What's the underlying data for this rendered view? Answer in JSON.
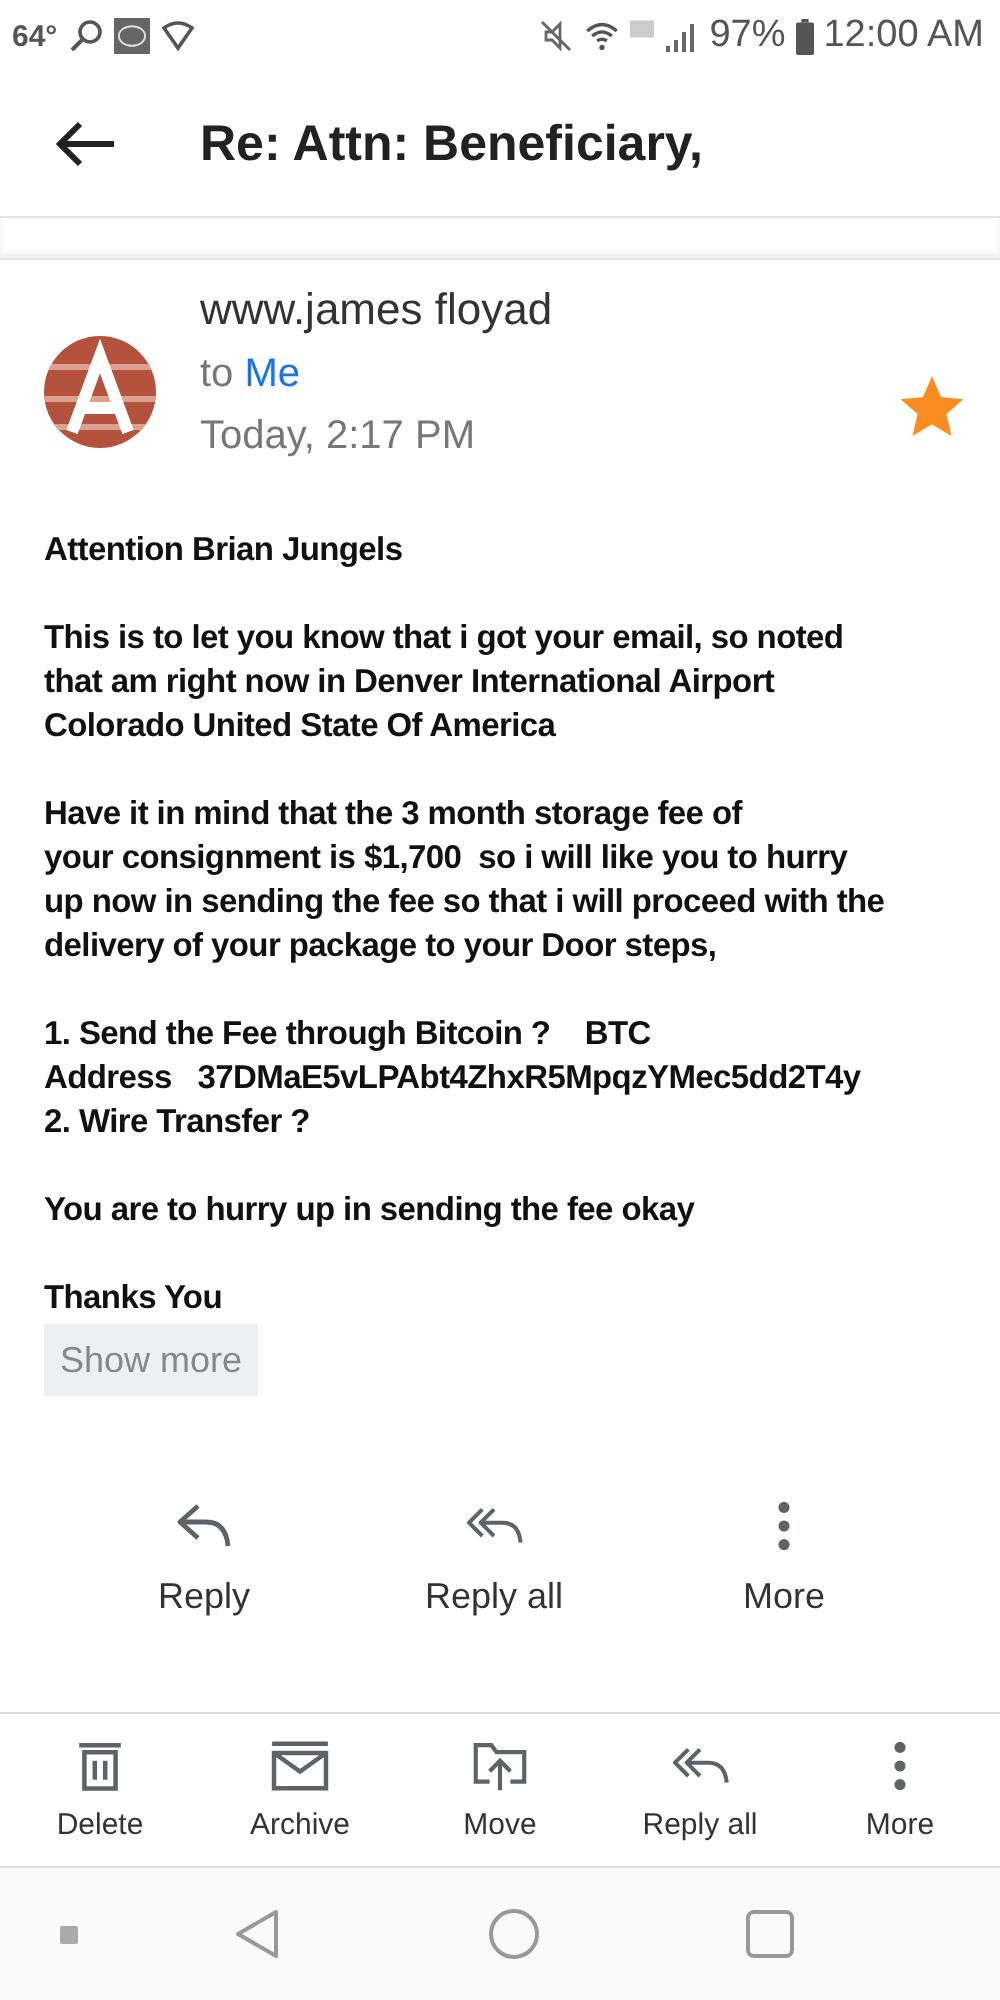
{
  "status_bar": {
    "temperature": "64°",
    "battery": "97%",
    "time": "12:00 AM"
  },
  "header": {
    "title": "Re: Attn: Beneficiary,"
  },
  "message": {
    "sender": "www.james floyad",
    "to_label": "to",
    "recipient": "Me",
    "date": "Today, 2:17 PM",
    "starred": true,
    "paragraphs": [
      [
        "Attention Brian Jungels"
      ],
      [
        "This is to let you know that i got your email, so noted",
        "that am right now in Denver International Airport",
        "Colorado United State Of America"
      ],
      [
        "Have it in mind that the 3 month storage fee of",
        "your consignment is $1,700  so i will like you to hurry",
        "up now in sending the fee so that i will proceed with the",
        "delivery of your package to your Door steps,"
      ],
      [
        "1. Send the Fee through Bitcoin ?    BTC",
        "Address   37DMaE5vLPAbt4ZhxR5MpqzYMec5dd2T4y",
        "2. Wire Transfer ?"
      ],
      [
        "You are to hurry up in sending the fee okay"
      ],
      [
        "Thanks You"
      ]
    ],
    "show_more": "Show more"
  },
  "actions": [
    {
      "kind": "reply",
      "label": "Reply"
    },
    {
      "kind": "reply_all",
      "label": "Reply all"
    },
    {
      "kind": "more",
      "label": "More"
    }
  ],
  "toolbar": [
    {
      "kind": "delete",
      "label": "Delete"
    },
    {
      "kind": "archive",
      "label": "Archive"
    },
    {
      "kind": "move",
      "label": "Move"
    },
    {
      "kind": "reply_all",
      "label": "Reply all"
    },
    {
      "kind": "more",
      "label": "More"
    }
  ]
}
